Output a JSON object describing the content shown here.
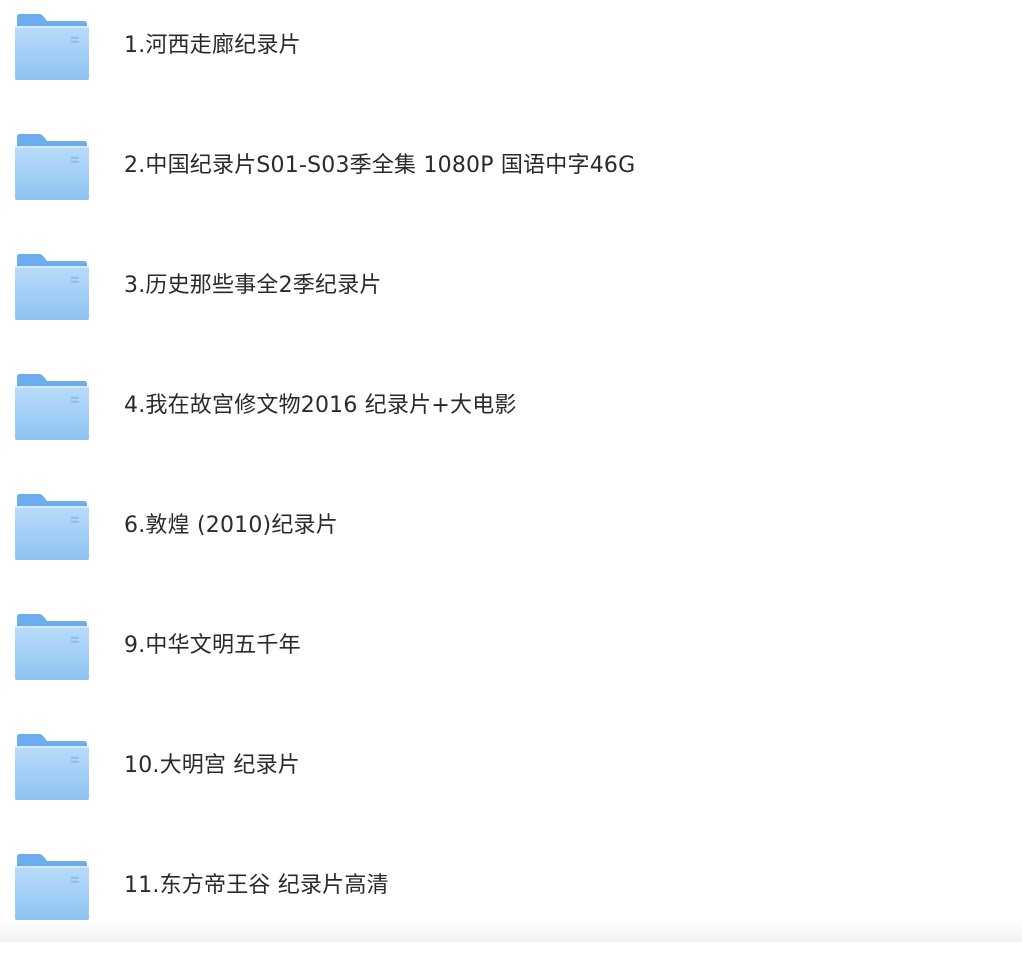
{
  "folders": [
    {
      "name": "1.河西走廊纪录片",
      "icon": "folder-icon"
    },
    {
      "name": "2.中国纪录片S01-S03季全集 1080P 国语中字46G",
      "icon": "folder-icon"
    },
    {
      "name": "3.历史那些事全2季纪录片",
      "icon": "folder-icon"
    },
    {
      "name": "4.我在故宫修文物2016 纪录片+大电影",
      "icon": "folder-icon"
    },
    {
      "name": "6.敦煌 (2010)纪录片",
      "icon": "folder-icon"
    },
    {
      "name": "9.中华文明五千年",
      "icon": "folder-icon"
    },
    {
      "name": "10.大明宫 纪录片",
      "icon": "folder-icon"
    },
    {
      "name": "11.东方帝王谷 纪录片高清",
      "icon": "folder-icon"
    }
  ],
  "colors": {
    "folder_back": "#6fb1ef",
    "folder_front_top": "#b7daf9",
    "folder_front_bottom": "#8fc4f3",
    "text": "#2a2a2e"
  }
}
